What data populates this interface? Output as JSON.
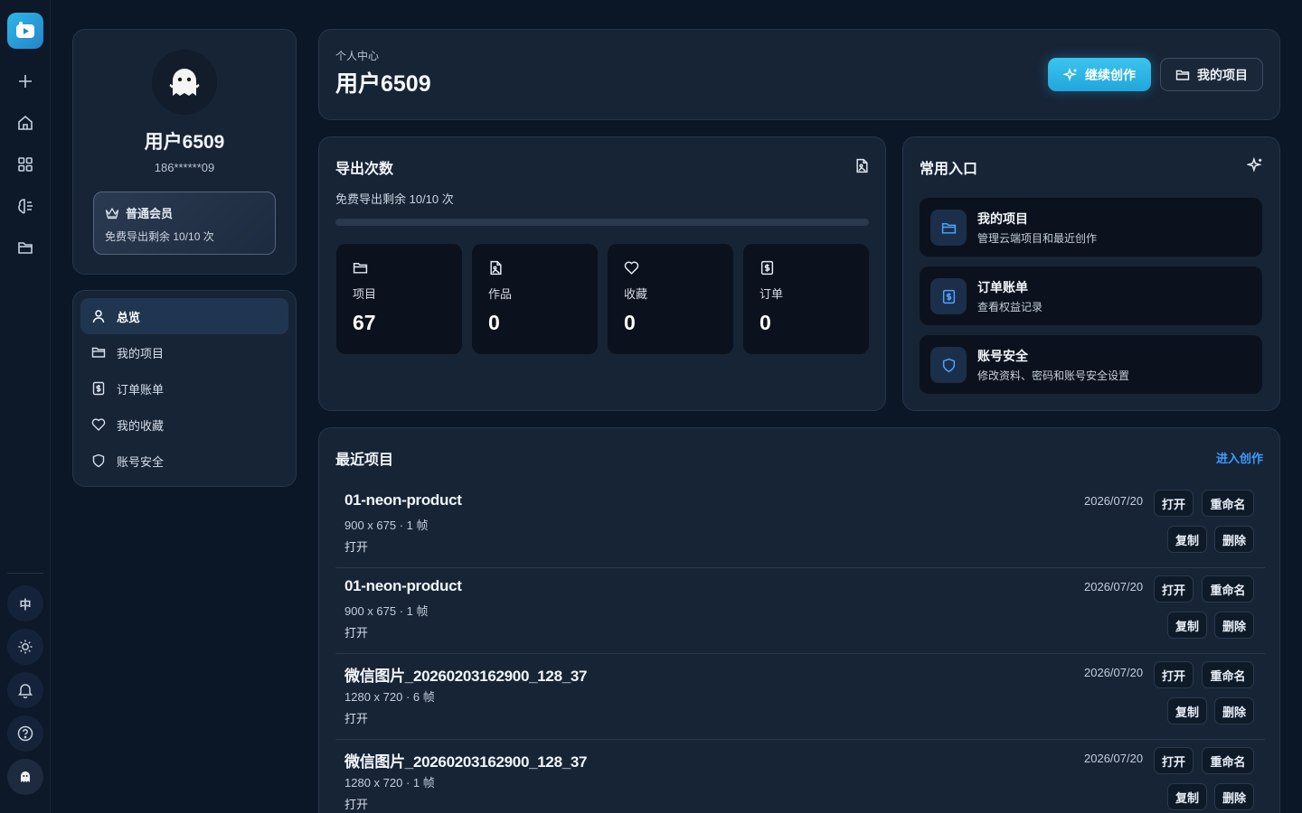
{
  "rail": {
    "icons": [
      "app-logo-icon",
      "plus-icon",
      "home-icon",
      "grid-icon",
      "brain-icon",
      "folder-icon"
    ],
    "lang_label": "中"
  },
  "profile": {
    "name": "用户6509",
    "phone": "186******09",
    "membership": {
      "title": "普通会员",
      "subtitle": "免费导出剩余 10/10 次"
    }
  },
  "menu": {
    "items": [
      {
        "label": "总览",
        "icon": "user-icon",
        "active": true
      },
      {
        "label": "我的项目",
        "icon": "folder-icon"
      },
      {
        "label": "订单账单",
        "icon": "receipt-icon"
      },
      {
        "label": "我的收藏",
        "icon": "heart-icon"
      },
      {
        "label": "账号安全",
        "icon": "shield-icon"
      }
    ]
  },
  "header": {
    "breadcrumb": "个人中心",
    "title": "用户6509",
    "primary_button": "继续创作",
    "secondary_button": "我的项目"
  },
  "export": {
    "title": "导出次数",
    "subtitle": "免费导出剩余 10/10 次",
    "progress_used_fraction": 0,
    "stats": [
      {
        "label": "项目",
        "value": "67",
        "icon": "folder-icon"
      },
      {
        "label": "作品",
        "value": "0",
        "icon": "image-file-icon"
      },
      {
        "label": "收藏",
        "value": "0",
        "icon": "heart-icon"
      },
      {
        "label": "订单",
        "value": "0",
        "icon": "receipt-icon"
      }
    ]
  },
  "quick": {
    "title": "常用入口",
    "items": [
      {
        "title": "我的项目",
        "subtitle": "管理云端项目和最近创作",
        "icon": "folder-icon"
      },
      {
        "title": "订单账单",
        "subtitle": "查看权益记录",
        "icon": "receipt-icon"
      },
      {
        "title": "账号安全",
        "subtitle": "修改资料、密码和账号安全设置",
        "icon": "shield-icon"
      }
    ]
  },
  "recent": {
    "title": "最近项目",
    "link": "进入创作",
    "rows": [
      {
        "name": "01-neon-product",
        "meta": "900 x 675 · 1 帧",
        "open_text": "打开",
        "date": "2026/07/20"
      },
      {
        "name": "01-neon-product",
        "meta": "900 x 675 · 1 帧",
        "open_text": "打开",
        "date": "2026/07/20"
      },
      {
        "name": "微信图片_20260203162900_128_37",
        "meta": "1280 x 720 · 6 帧",
        "open_text": "打开",
        "date": "2026/07/20"
      },
      {
        "name": "微信图片_20260203162900_128_37",
        "meta": "1280 x 720 · 1 帧",
        "open_text": "打开",
        "date": "2026/07/20"
      }
    ],
    "actions": {
      "open": "打开",
      "rename": "重命名",
      "copy": "复制",
      "delete": "删除"
    }
  },
  "colors": {
    "background": "#0b1626",
    "panel": "#172436",
    "accent": "#2fb6e8",
    "link": "#3f9bff"
  }
}
